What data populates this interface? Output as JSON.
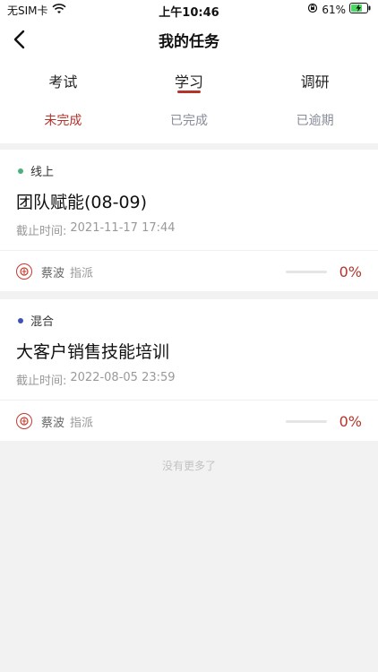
{
  "status_bar": {
    "carrier": "无SIM卡",
    "time": "上午10:46",
    "battery": "61%"
  },
  "nav": {
    "title": "我的任务"
  },
  "main_tabs": [
    {
      "label": "考试"
    },
    {
      "label": "学习"
    },
    {
      "label": "调研"
    }
  ],
  "sub_tabs": [
    {
      "label": "未完成"
    },
    {
      "label": "已完成"
    },
    {
      "label": "已逾期"
    }
  ],
  "tasks": [
    {
      "type": "线上",
      "type_color": "#4caf7d",
      "title": "团队赋能(08-09)",
      "deadline_label": "截止时间:",
      "deadline": "2021-11-17 17:44",
      "assigner": "蔡波",
      "assign_label": "指派",
      "progress": 0,
      "progress_text": "0%"
    },
    {
      "type": "混合",
      "type_color": "#3f51b5",
      "title": "大客户销售技能培训",
      "deadline_label": "截止时间:",
      "deadline": "2022-08-05 23:59",
      "assigner": "蔡波",
      "assign_label": "指派",
      "progress": 0,
      "progress_text": "0%"
    }
  ],
  "footer_text": "没有更多了",
  "colors": {
    "accent": "#b5332b",
    "muted": "#888c99"
  }
}
